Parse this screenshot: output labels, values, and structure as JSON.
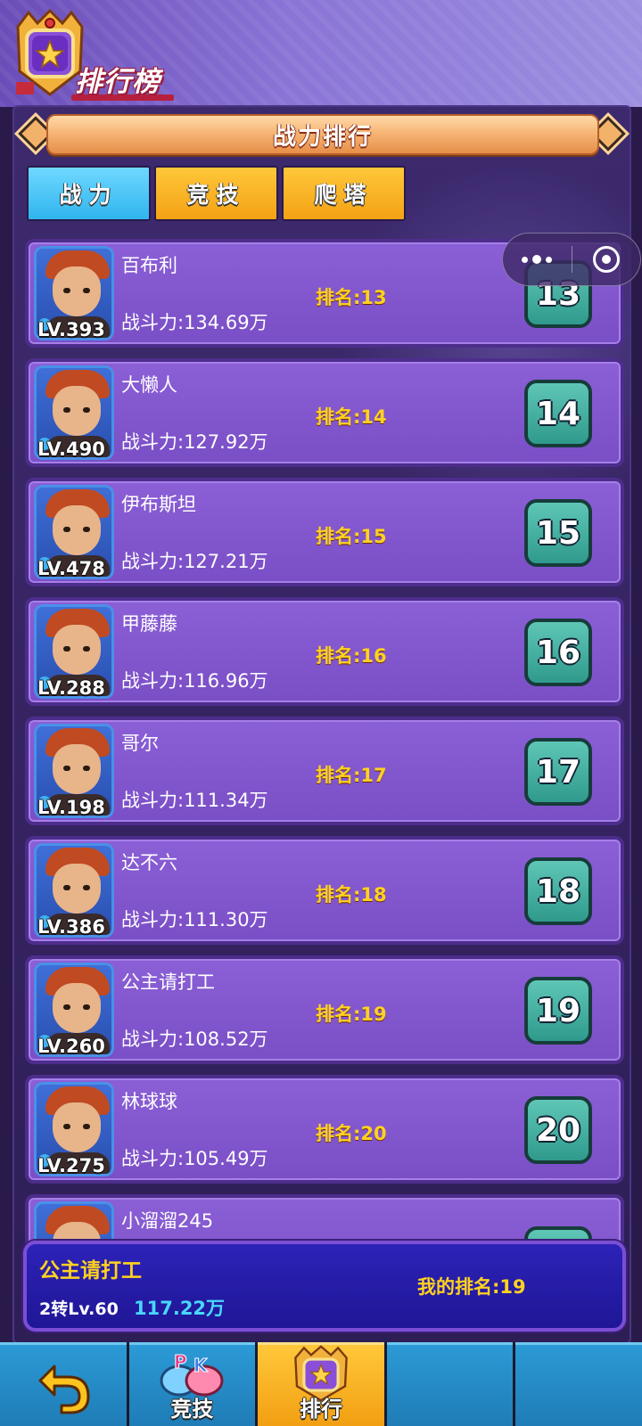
{
  "header": {
    "title": "排行榜"
  },
  "banner": {
    "title": "战力排行"
  },
  "tabs": [
    {
      "label": "战力",
      "active": true
    },
    {
      "label": "竞技",
      "active": false
    },
    {
      "label": "爬塔",
      "active": false
    }
  ],
  "players": [
    {
      "name": "百布利",
      "level": "LV.393",
      "power": "战斗力:134.69万",
      "rank_text": "排名:13",
      "rank": "13"
    },
    {
      "name": "大懒人",
      "level": "LV.490",
      "power": "战斗力:127.92万",
      "rank_text": "排名:14",
      "rank": "14"
    },
    {
      "name": "伊布斯坦",
      "level": "LV.478",
      "power": "战斗力:127.21万",
      "rank_text": "排名:15",
      "rank": "15"
    },
    {
      "name": "甲藤藤",
      "level": "LV.288",
      "power": "战斗力:116.96万",
      "rank_text": "排名:16",
      "rank": "16"
    },
    {
      "name": "哥尔",
      "level": "LV.198",
      "power": "战斗力:111.34万",
      "rank_text": "排名:17",
      "rank": "17"
    },
    {
      "name": "达不六",
      "level": "LV.386",
      "power": "战斗力:111.30万",
      "rank_text": "排名:18",
      "rank": "18"
    },
    {
      "name": "公主请打工",
      "level": "LV.260",
      "power": "战斗力:108.52万",
      "rank_text": "排名:19",
      "rank": "19"
    },
    {
      "name": "林球球",
      "level": "LV.275",
      "power": "战斗力:105.49万",
      "rank_text": "排名:20",
      "rank": "20"
    },
    {
      "name": "小溜溜245",
      "level": "",
      "power": "",
      "rank_text": "",
      "rank": ""
    }
  ],
  "my_rank": {
    "name": "公主请打工",
    "level": "2转Lv.60",
    "power": "117.22万",
    "rank_text": "我的排名:19"
  },
  "bottom_nav": [
    {
      "label": "",
      "icon": "back-arrow-icon"
    },
    {
      "label": "竞技",
      "icon": "pk-icon"
    },
    {
      "label": "排行",
      "icon": "trophy-crest-icon",
      "active": true
    },
    {
      "label": "",
      "icon": ""
    },
    {
      "label": "",
      "icon": ""
    }
  ],
  "colors": {
    "accent_yellow": "#ffd21f",
    "tab_active": "#2fb5ee",
    "tab_inactive": "#f3a214",
    "row_bg": "#8b5fd6",
    "badge_teal": "#2f9a8c"
  }
}
